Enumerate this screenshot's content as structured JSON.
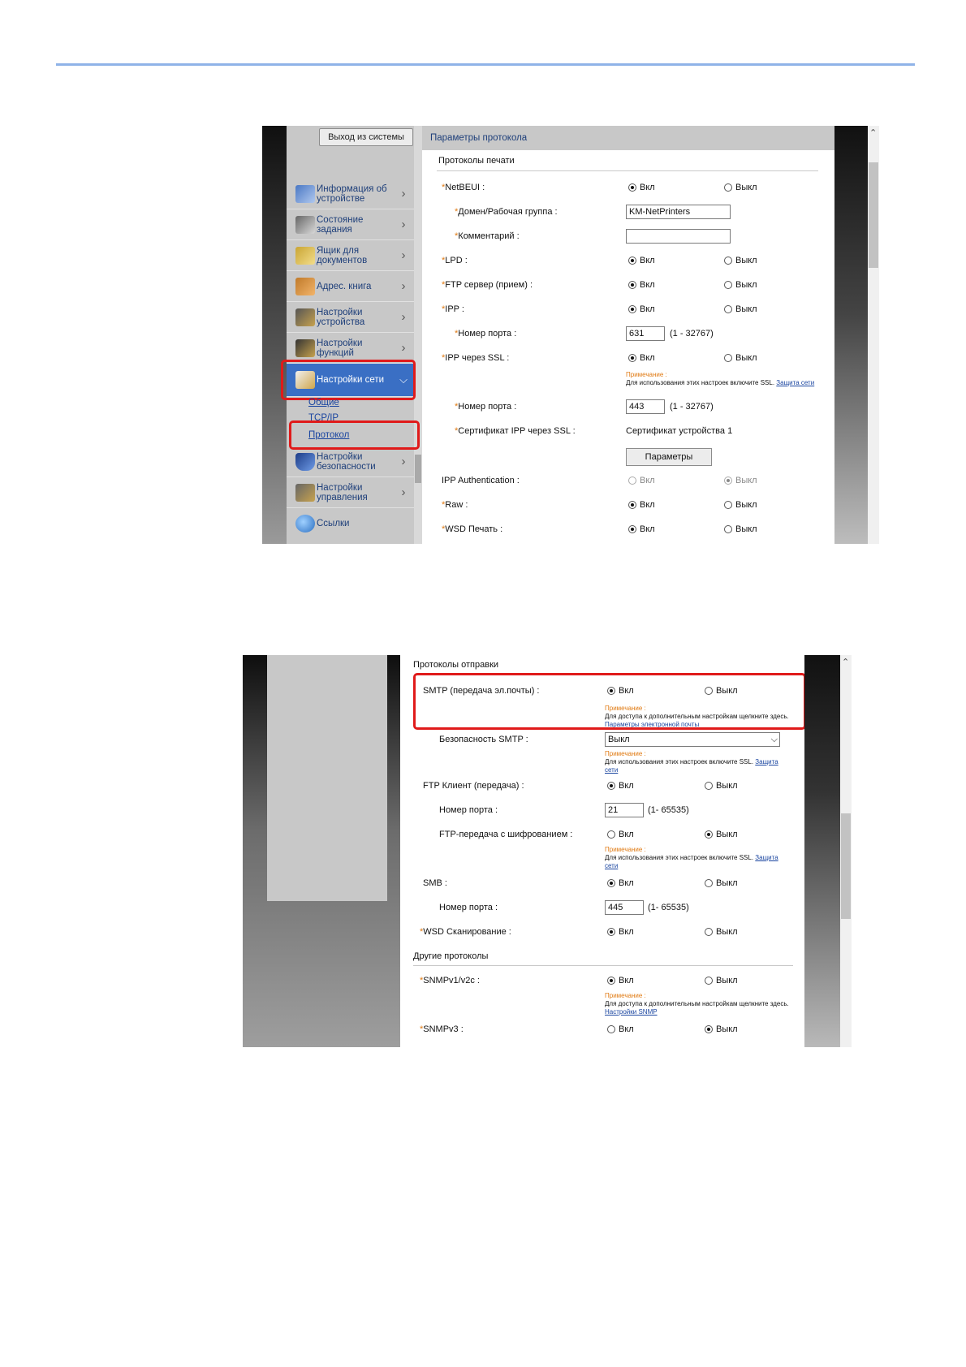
{
  "shot1": {
    "logout_label": "Выход из системы",
    "sidebar": {
      "items": [
        {
          "label": "Информация об устройстве",
          "icon": "device-info-icon"
        },
        {
          "label": "Состояние задания",
          "icon": "job-status-icon"
        },
        {
          "label": "Ящик для документов",
          "icon": "document-box-icon"
        },
        {
          "label": "Адрес. книга",
          "icon": "address-book-icon"
        },
        {
          "label": "Настройки устройства",
          "icon": "device-settings-icon"
        },
        {
          "label": "Настройки функций",
          "icon": "function-settings-icon"
        },
        {
          "label": "Настройки сети",
          "icon": "network-settings-icon"
        },
        {
          "label": "Настройки безопасности",
          "icon": "security-shield-icon"
        },
        {
          "label": "Настройки управления",
          "icon": "management-icon"
        },
        {
          "label": "Ссылки",
          "icon": "globe-icon"
        }
      ],
      "sub_items": [
        "Общие",
        "TCP/IP",
        "Протокол"
      ]
    },
    "content": {
      "header": "Параметры протокола",
      "section": "Протоколы печати",
      "on": "Вкл",
      "off": "Выкл",
      "netbeui": "NetBEUI :",
      "domain_label": "Домен/Рабочая группа :",
      "domain_value": "KM-NetPrinters",
      "comment_label": "Комментарий :",
      "comment_value": "",
      "lpd": "LPD :",
      "ftp_server": "FTP сервер (прием) :",
      "ipp": "IPP :",
      "port_label": "Номер порта :",
      "ipp_port": "631",
      "port_range": "(1 - 32767)",
      "ipp_ssl": "IPP через SSL :",
      "note_title": "Примечание :",
      "note_ssl": "Для использования этих настроек включите SSL.",
      "note_ssl_link": "Защита сети",
      "ipp_ssl_port": "443",
      "cert_label": "Сертификат IPP через SSL :",
      "cert_value": "Сертификат устройства 1",
      "params_button": "Параметры",
      "ipp_auth": "IPP Authentication :",
      "raw": "Raw :",
      "wsd_print": "WSD Печать :"
    }
  },
  "shot2": {
    "on": "Вкл",
    "off": "Выкл",
    "send_section": "Протоколы отправки",
    "smtp": "SMTP (передача эл.почты) :",
    "note_title": "Примечание :",
    "note_more": "Для доступа к дополнительным настройкам щелкните здесь.",
    "email_link": "Параметры электронной почты",
    "smtp_security": "Безопасность SMTP :",
    "smtp_security_value": "Выкл",
    "note_ssl": "Для использования этих настроек включите SSL.",
    "note_ssl_link": "Защита сети",
    "ftp_client": "FTP Клиент (передача) :",
    "port_label": "Номер порта :",
    "ftp_port": "21",
    "ftp_range": "(1- 65535)",
    "ftp_encrypted": "FTP-передача с шифрованием :",
    "smb": "SMB :",
    "smb_port": "445",
    "smb_range": "(1- 65535)",
    "wsd_scan": "WSD Сканирование :",
    "other_section": "Другие протоколы",
    "snmpv1": "SNMPv1/v2c :",
    "snmp_link": "Настройки SNMP",
    "snmpv3": "SNMPv3 :"
  }
}
